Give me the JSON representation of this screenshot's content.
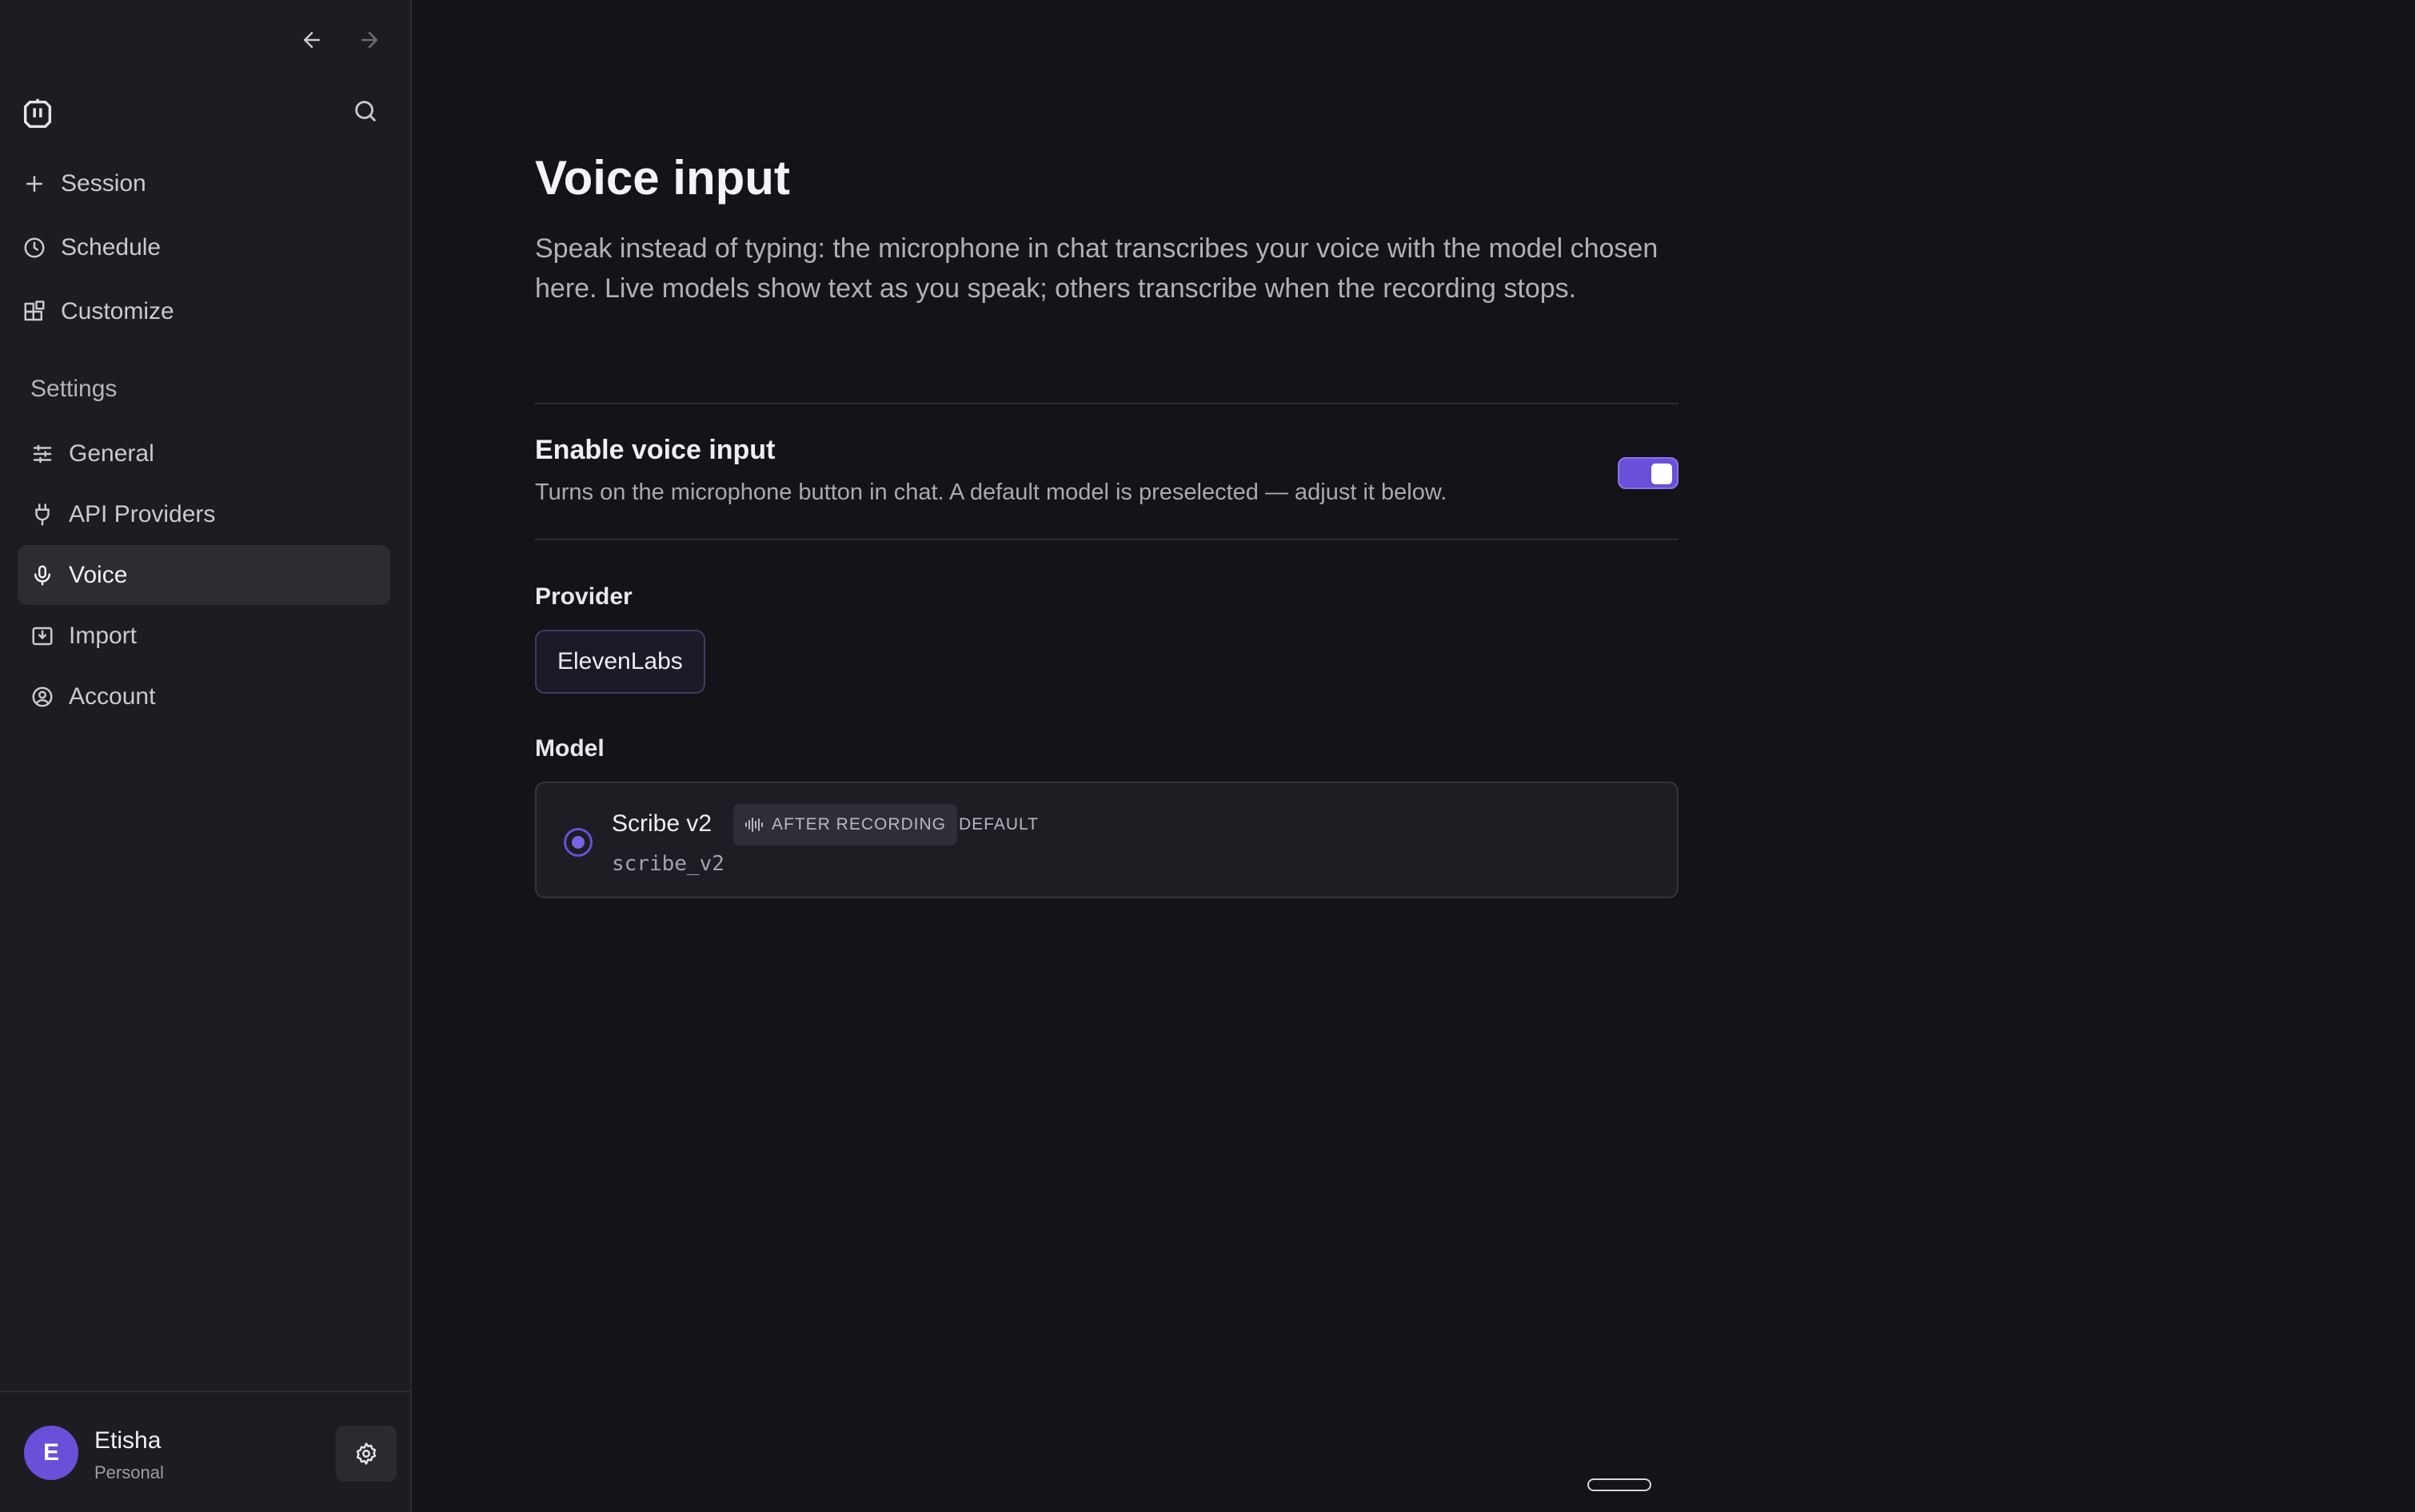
{
  "sidebar": {
    "top_items": [
      {
        "label": "Session",
        "icon": "plus-icon"
      },
      {
        "label": "Schedule",
        "icon": "clock-icon"
      },
      {
        "label": "Customize",
        "icon": "blocks-icon"
      }
    ],
    "section_label": "Settings",
    "settings_items": [
      {
        "label": "General",
        "icon": "sliders-icon"
      },
      {
        "label": "API Providers",
        "icon": "plug-icon"
      },
      {
        "label": "Voice",
        "icon": "microphone-icon",
        "active": true
      },
      {
        "label": "Import",
        "icon": "import-icon"
      },
      {
        "label": "Account",
        "icon": "user-circle-icon"
      }
    ],
    "user": {
      "initial": "E",
      "name": "Etisha",
      "plan": "Personal"
    }
  },
  "main": {
    "title": "Voice input",
    "description": "Speak instead of typing: the microphone in chat transcribes your voice with the model chosen here. Live models show text as you speak; others transcribe when the recording stops.",
    "toggle": {
      "title": "Enable voice input",
      "description": "Turns on the microphone button in chat. A default model is preselected — adjust it below.",
      "enabled": true
    },
    "provider_label": "Provider",
    "provider_value": "ElevenLabs",
    "model_label": "Model",
    "model": {
      "name": "Scribe v2",
      "badge": "AFTER RECORDING",
      "tag": "DEFAULT",
      "id": "scribe_v2",
      "selected": true
    }
  },
  "colors": {
    "accent": "#6a4fd8",
    "background": "#131318",
    "sidebar": "#1c1c21"
  }
}
